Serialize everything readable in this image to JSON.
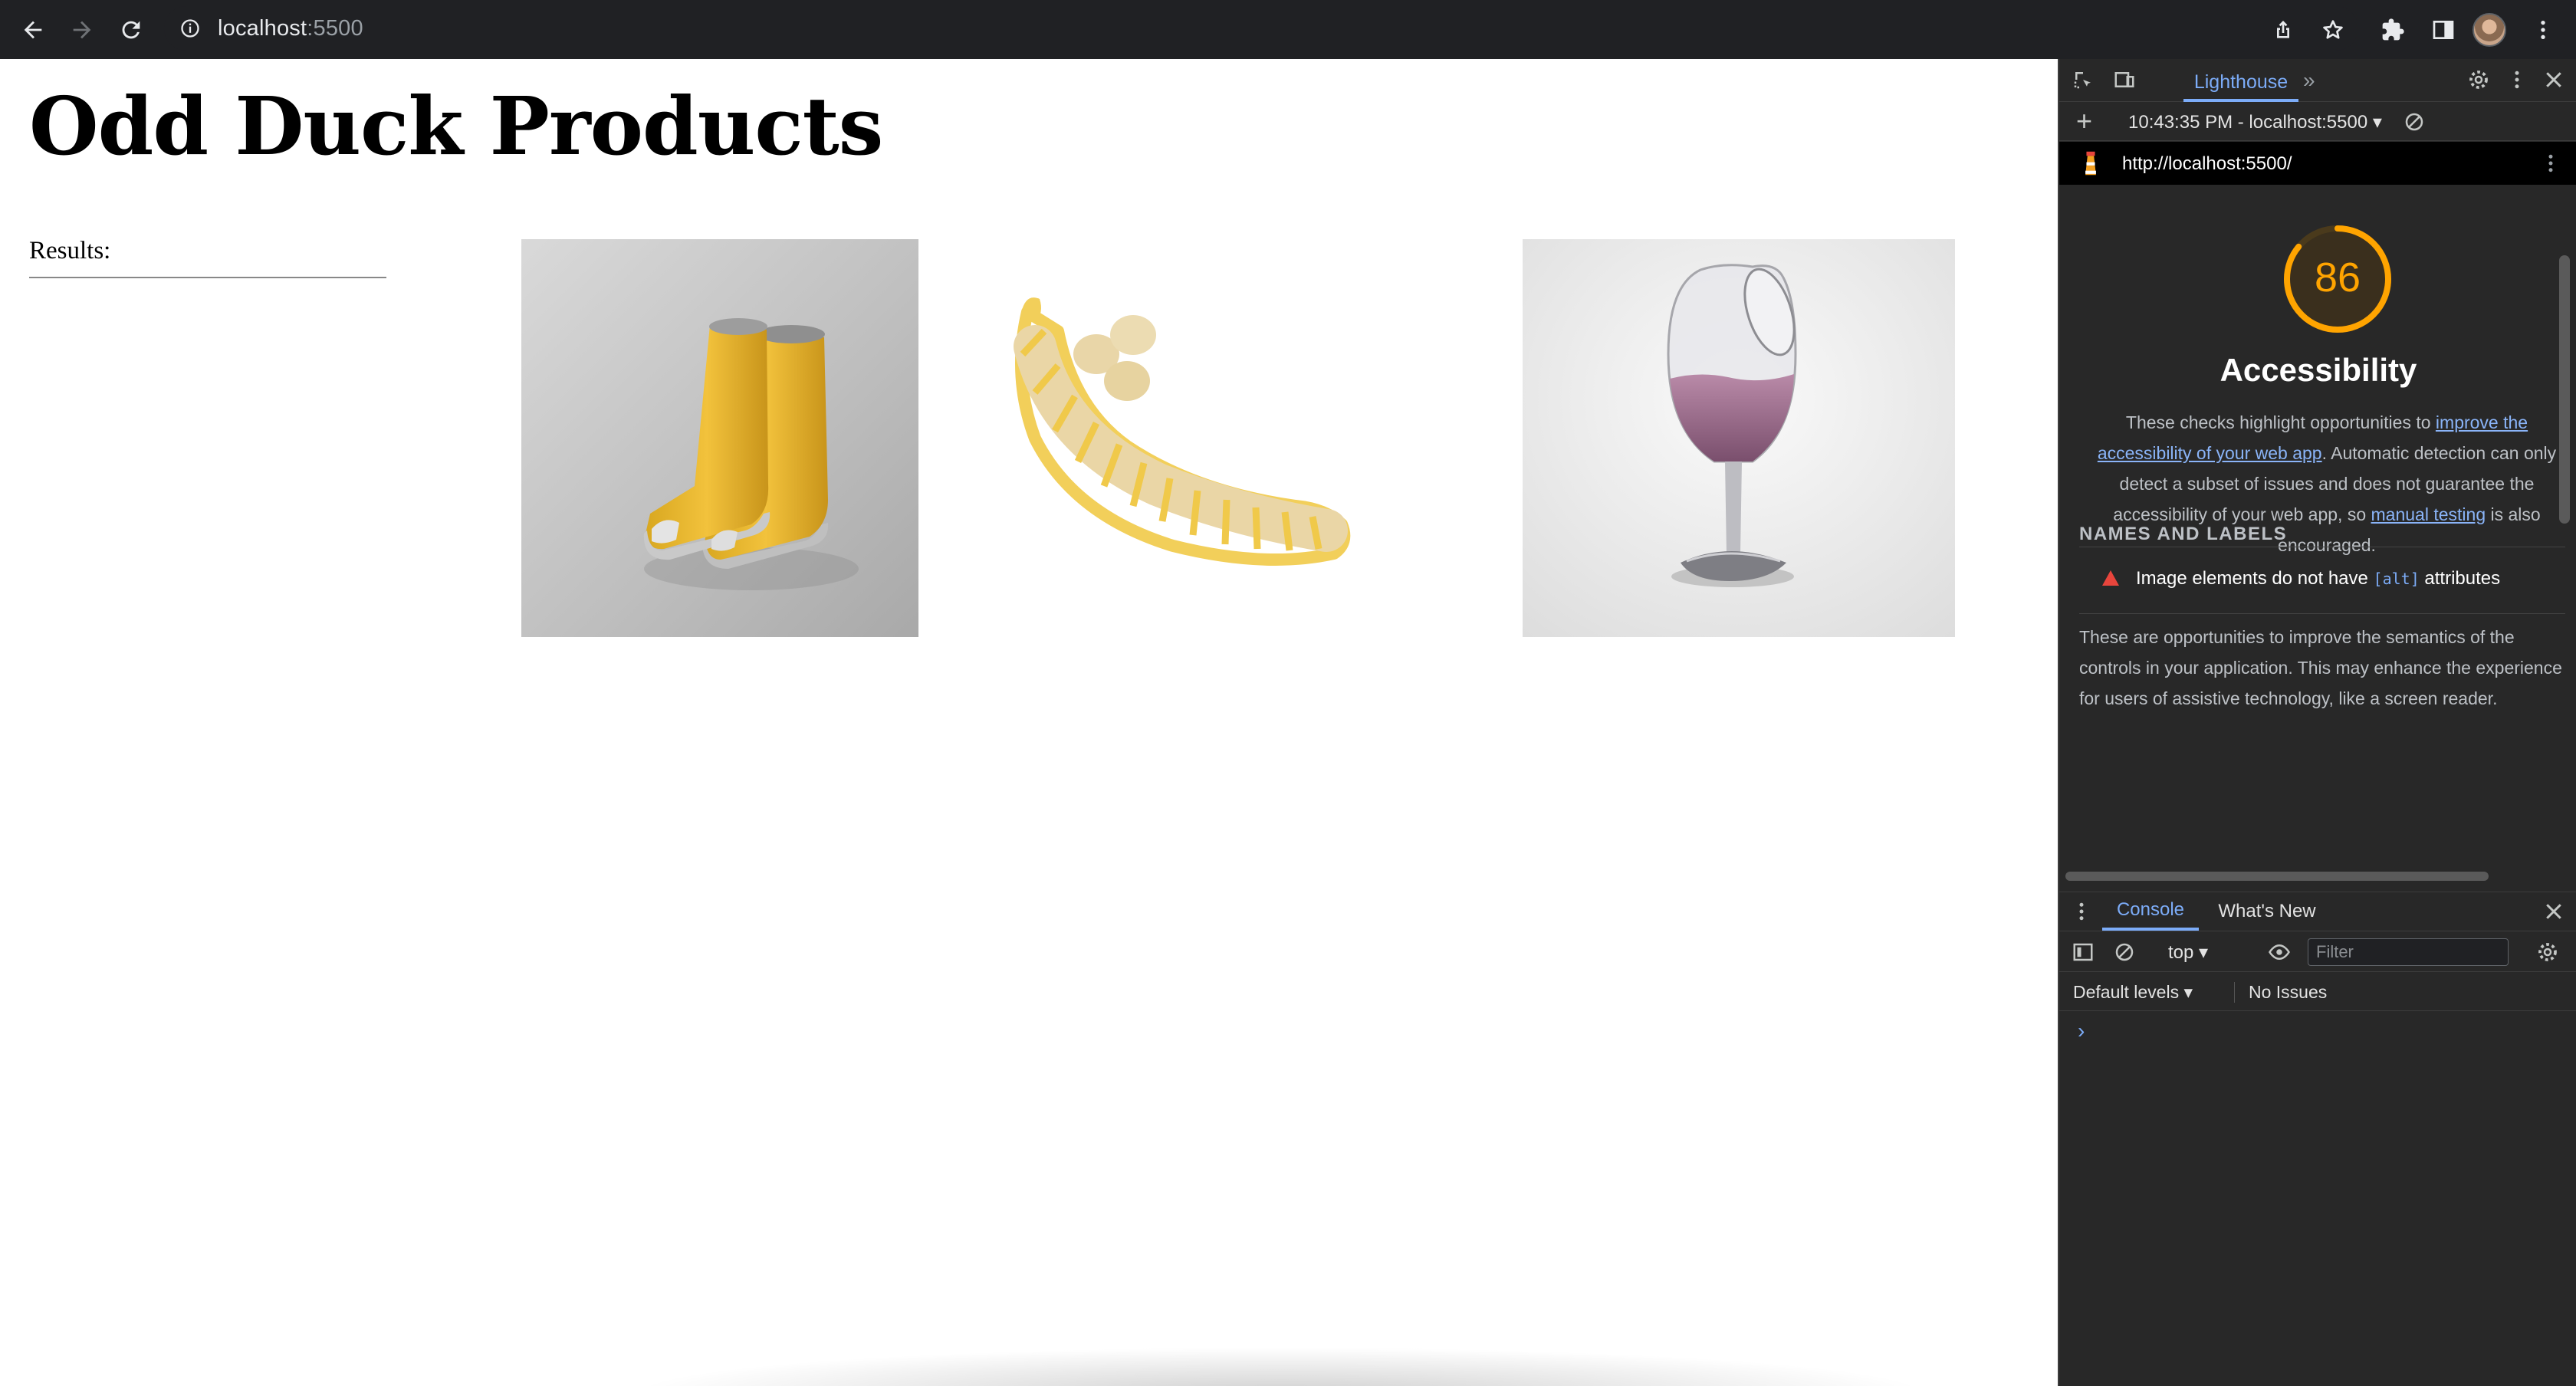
{
  "browser": {
    "url_host": "localhost",
    "url_port": ":5500"
  },
  "page": {
    "title": "Odd Duck Products",
    "results_label": "Results:",
    "products": [
      {
        "name": "boots"
      },
      {
        "name": "banana-slicer"
      },
      {
        "name": "wine-glass"
      }
    ]
  },
  "devtools": {
    "active_tab": "Lighthouse",
    "report_selector": "10:43:35 PM - localhost:5500 ▾",
    "report_url": "http://localhost:5500/",
    "score": "86",
    "score_value": 86,
    "score_color": "#ffa400",
    "category_title": "Accessibility",
    "desc": {
      "p1": "These checks highlight opportunities to ",
      "link1": "improve the accessibility of your web app",
      "p2": ". Automatic detection can only detect a subset of issues and does not guarantee the accessibility of your web app, so ",
      "link2": "manual testing",
      "p3": " is also encouraged."
    },
    "group_title": "NAMES AND LABELS",
    "audit": {
      "pre": "Image elements do not have ",
      "code": "[alt]",
      "post": " attributes",
      "status_color": "#e8453c"
    },
    "group_desc": "These are opportunities to improve the semantics of the controls in your application. This may enhance the experience for users of assistive technology, like a screen reader."
  },
  "drawer": {
    "tabs": [
      "Console",
      "What's New"
    ],
    "context": "top ▾",
    "filter_placeholder": "Filter",
    "levels": "Default levels ▾",
    "issues": "No Issues",
    "prompt": "›"
  }
}
